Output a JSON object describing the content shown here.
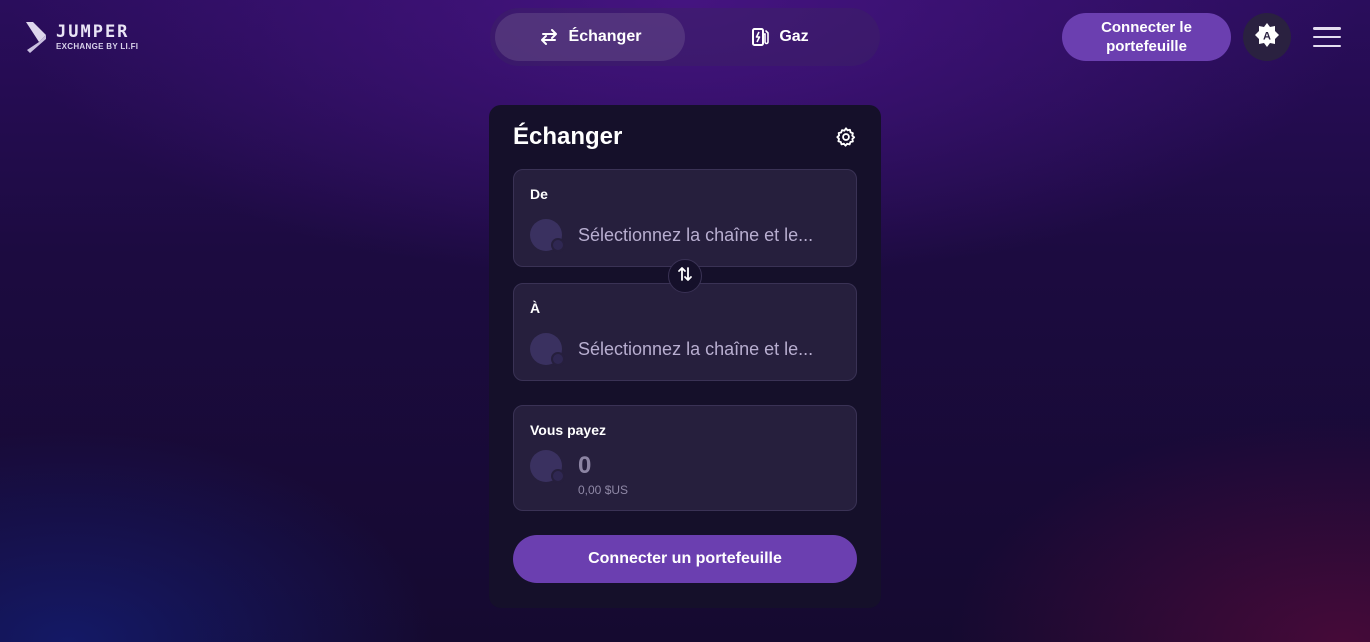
{
  "brand": {
    "logo_word": "JUMPER",
    "logo_sub": "EXCHANGE BY LI.FI"
  },
  "nav": {
    "tabs": [
      {
        "label": "Échanger",
        "icon": "swap-arrows-icon",
        "active": true
      },
      {
        "label": "Gaz",
        "icon": "gas-pump-icon",
        "active": false
      }
    ]
  },
  "header": {
    "connect_label": "Connecter le portefeuille",
    "theme_icon": "auto-theme-icon",
    "menu_icon": "hamburger-menu-icon"
  },
  "card": {
    "title": "Échanger",
    "from": {
      "label": "De",
      "placeholder": "Sélectionnez la chaîne et le..."
    },
    "to": {
      "label": "À",
      "placeholder": "Sélectionnez la chaîne et le..."
    },
    "pay": {
      "label": "Vous payez",
      "amount": "0",
      "usd": "0,00 $US"
    },
    "connect_label": "Connecter un portefeuille"
  },
  "colors": {
    "accent": "#6b3fb0",
    "card_bg": "#15102a",
    "panel_bg": "#261f3d"
  }
}
